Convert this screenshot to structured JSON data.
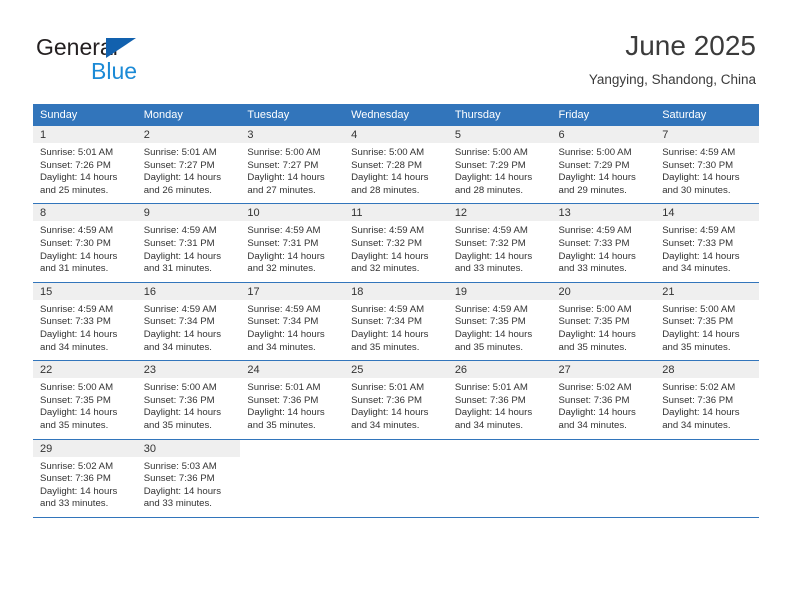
{
  "brand": {
    "name_part1": "General",
    "name_part2": "Blue",
    "logo_icon": "triangle-logo-icon"
  },
  "header": {
    "month_title": "June 2025",
    "location": "Yangying, Shandong, China"
  },
  "colors": {
    "header_blue": "#3275bb",
    "brand_dark_blue": "#1261ae",
    "brand_light_blue": "#1b8ad6",
    "daynum_band": "#efefef",
    "text": "#333333"
  },
  "weekdays": [
    "Sunday",
    "Monday",
    "Tuesday",
    "Wednesday",
    "Thursday",
    "Friday",
    "Saturday"
  ],
  "labels": {
    "sunrise_prefix": "Sunrise:",
    "sunset_prefix": "Sunset:",
    "daylight_prefix": "Daylight:"
  },
  "weeks": [
    [
      {
        "day": "1",
        "sunrise": "Sunrise: 5:01 AM",
        "sunset": "Sunset: 7:26 PM",
        "daylight": "Daylight: 14 hours and 25 minutes."
      },
      {
        "day": "2",
        "sunrise": "Sunrise: 5:01 AM",
        "sunset": "Sunset: 7:27 PM",
        "daylight": "Daylight: 14 hours and 26 minutes."
      },
      {
        "day": "3",
        "sunrise": "Sunrise: 5:00 AM",
        "sunset": "Sunset: 7:27 PM",
        "daylight": "Daylight: 14 hours and 27 minutes."
      },
      {
        "day": "4",
        "sunrise": "Sunrise: 5:00 AM",
        "sunset": "Sunset: 7:28 PM",
        "daylight": "Daylight: 14 hours and 28 minutes."
      },
      {
        "day": "5",
        "sunrise": "Sunrise: 5:00 AM",
        "sunset": "Sunset: 7:29 PM",
        "daylight": "Daylight: 14 hours and 28 minutes."
      },
      {
        "day": "6",
        "sunrise": "Sunrise: 5:00 AM",
        "sunset": "Sunset: 7:29 PM",
        "daylight": "Daylight: 14 hours and 29 minutes."
      },
      {
        "day": "7",
        "sunrise": "Sunrise: 4:59 AM",
        "sunset": "Sunset: 7:30 PM",
        "daylight": "Daylight: 14 hours and 30 minutes."
      }
    ],
    [
      {
        "day": "8",
        "sunrise": "Sunrise: 4:59 AM",
        "sunset": "Sunset: 7:30 PM",
        "daylight": "Daylight: 14 hours and 31 minutes."
      },
      {
        "day": "9",
        "sunrise": "Sunrise: 4:59 AM",
        "sunset": "Sunset: 7:31 PM",
        "daylight": "Daylight: 14 hours and 31 minutes."
      },
      {
        "day": "10",
        "sunrise": "Sunrise: 4:59 AM",
        "sunset": "Sunset: 7:31 PM",
        "daylight": "Daylight: 14 hours and 32 minutes."
      },
      {
        "day": "11",
        "sunrise": "Sunrise: 4:59 AM",
        "sunset": "Sunset: 7:32 PM",
        "daylight": "Daylight: 14 hours and 32 minutes."
      },
      {
        "day": "12",
        "sunrise": "Sunrise: 4:59 AM",
        "sunset": "Sunset: 7:32 PM",
        "daylight": "Daylight: 14 hours and 33 minutes."
      },
      {
        "day": "13",
        "sunrise": "Sunrise: 4:59 AM",
        "sunset": "Sunset: 7:33 PM",
        "daylight": "Daylight: 14 hours and 33 minutes."
      },
      {
        "day": "14",
        "sunrise": "Sunrise: 4:59 AM",
        "sunset": "Sunset: 7:33 PM",
        "daylight": "Daylight: 14 hours and 34 minutes."
      }
    ],
    [
      {
        "day": "15",
        "sunrise": "Sunrise: 4:59 AM",
        "sunset": "Sunset: 7:33 PM",
        "daylight": "Daylight: 14 hours and 34 minutes."
      },
      {
        "day": "16",
        "sunrise": "Sunrise: 4:59 AM",
        "sunset": "Sunset: 7:34 PM",
        "daylight": "Daylight: 14 hours and 34 minutes."
      },
      {
        "day": "17",
        "sunrise": "Sunrise: 4:59 AM",
        "sunset": "Sunset: 7:34 PM",
        "daylight": "Daylight: 14 hours and 34 minutes."
      },
      {
        "day": "18",
        "sunrise": "Sunrise: 4:59 AM",
        "sunset": "Sunset: 7:34 PM",
        "daylight": "Daylight: 14 hours and 35 minutes."
      },
      {
        "day": "19",
        "sunrise": "Sunrise: 4:59 AM",
        "sunset": "Sunset: 7:35 PM",
        "daylight": "Daylight: 14 hours and 35 minutes."
      },
      {
        "day": "20",
        "sunrise": "Sunrise: 5:00 AM",
        "sunset": "Sunset: 7:35 PM",
        "daylight": "Daylight: 14 hours and 35 minutes."
      },
      {
        "day": "21",
        "sunrise": "Sunrise: 5:00 AM",
        "sunset": "Sunset: 7:35 PM",
        "daylight": "Daylight: 14 hours and 35 minutes."
      }
    ],
    [
      {
        "day": "22",
        "sunrise": "Sunrise: 5:00 AM",
        "sunset": "Sunset: 7:35 PM",
        "daylight": "Daylight: 14 hours and 35 minutes."
      },
      {
        "day": "23",
        "sunrise": "Sunrise: 5:00 AM",
        "sunset": "Sunset: 7:36 PM",
        "daylight": "Daylight: 14 hours and 35 minutes."
      },
      {
        "day": "24",
        "sunrise": "Sunrise: 5:01 AM",
        "sunset": "Sunset: 7:36 PM",
        "daylight": "Daylight: 14 hours and 35 minutes."
      },
      {
        "day": "25",
        "sunrise": "Sunrise: 5:01 AM",
        "sunset": "Sunset: 7:36 PM",
        "daylight": "Daylight: 14 hours and 34 minutes."
      },
      {
        "day": "26",
        "sunrise": "Sunrise: 5:01 AM",
        "sunset": "Sunset: 7:36 PM",
        "daylight": "Daylight: 14 hours and 34 minutes."
      },
      {
        "day": "27",
        "sunrise": "Sunrise: 5:02 AM",
        "sunset": "Sunset: 7:36 PM",
        "daylight": "Daylight: 14 hours and 34 minutes."
      },
      {
        "day": "28",
        "sunrise": "Sunrise: 5:02 AM",
        "sunset": "Sunset: 7:36 PM",
        "daylight": "Daylight: 14 hours and 34 minutes."
      }
    ],
    [
      {
        "day": "29",
        "sunrise": "Sunrise: 5:02 AM",
        "sunset": "Sunset: 7:36 PM",
        "daylight": "Daylight: 14 hours and 33 minutes."
      },
      {
        "day": "30",
        "sunrise": "Sunrise: 5:03 AM",
        "sunset": "Sunset: 7:36 PM",
        "daylight": "Daylight: 14 hours and 33 minutes."
      },
      {
        "day": "",
        "sunrise": "",
        "sunset": "",
        "daylight": ""
      },
      {
        "day": "",
        "sunrise": "",
        "sunset": "",
        "daylight": ""
      },
      {
        "day": "",
        "sunrise": "",
        "sunset": "",
        "daylight": ""
      },
      {
        "day": "",
        "sunrise": "",
        "sunset": "",
        "daylight": ""
      },
      {
        "day": "",
        "sunrise": "",
        "sunset": "",
        "daylight": ""
      }
    ]
  ]
}
